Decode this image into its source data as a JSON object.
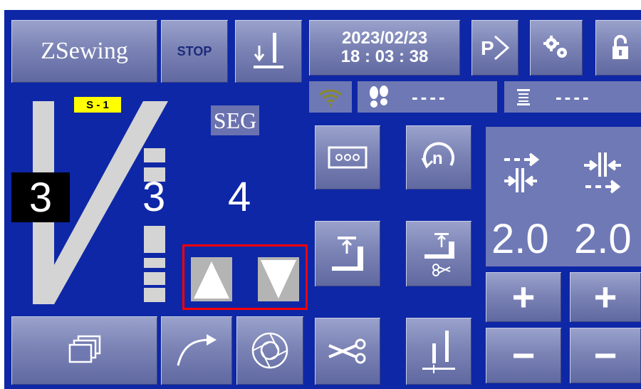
{
  "app": {
    "title": "ZSewing"
  },
  "toolbar": {
    "stop_label": "STOP"
  },
  "clock": {
    "date": "2023/02/23",
    "time": "18 : 03 : 38"
  },
  "status": {
    "stitch_count": "----",
    "piece_count": "----"
  },
  "pattern": {
    "badge": "S - 1",
    "segment_label": "SEG",
    "left_value": "3",
    "mid_value": "3",
    "segment_value": "4"
  },
  "stitch": {
    "left_length": "2.0",
    "right_length": "2.0"
  },
  "buttons": {
    "plus": "+",
    "minus": "−"
  },
  "colors": {
    "background": "#0e27a6",
    "button": "#7c84b6",
    "badge": "#ffff00",
    "highlight": "#ff0000"
  },
  "icons": [
    "needle-down-icon",
    "program-icon",
    "settings-gears-icon",
    "unlock-icon",
    "wifi-icon",
    "footprint-icon",
    "counter-list-icon",
    "pattern-icon",
    "repeat-n-icon",
    "presser-foot-icon",
    "trim-foot-icon",
    "stack-icon",
    "curve-icon",
    "aperture-icon",
    "scissors-icon",
    "needle-pair-icon",
    "arrow-up-icon",
    "arrow-down-icon"
  ]
}
